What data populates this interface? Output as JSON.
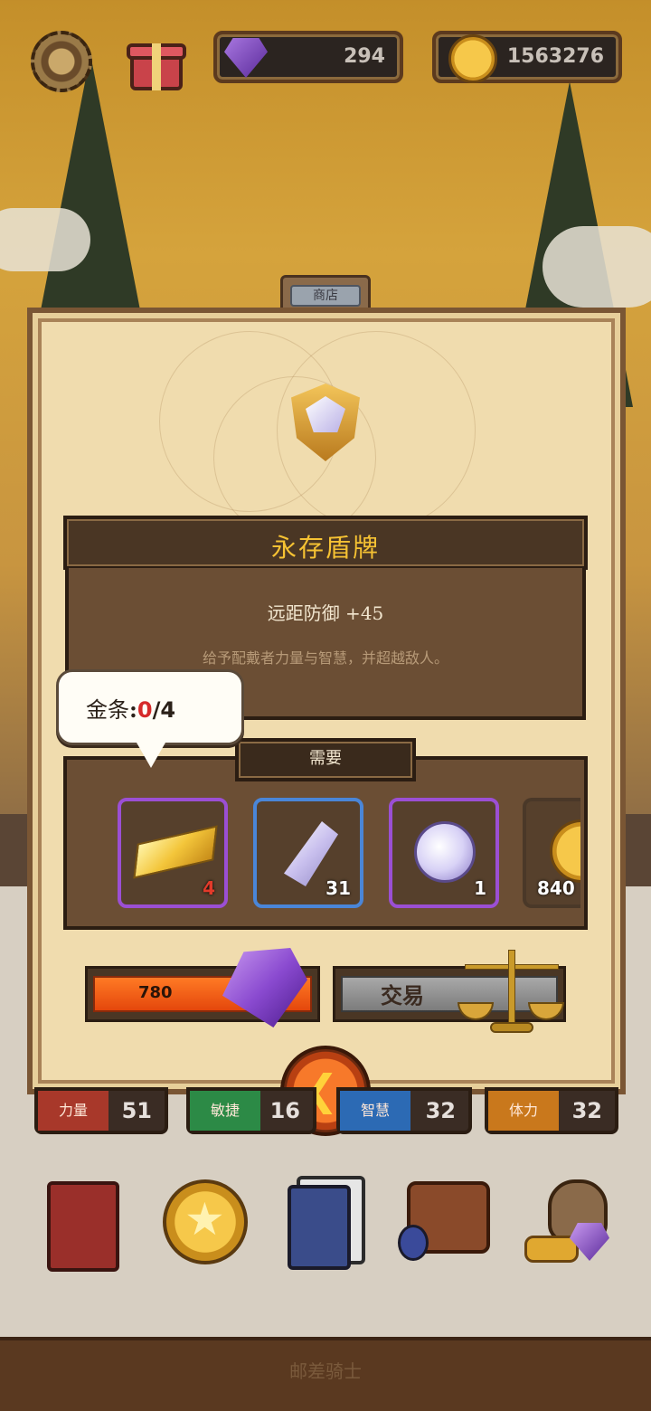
{
  "hud": {
    "gems": "294",
    "coins": "1563276",
    "icons": [
      "gear-icon",
      "gift-icon",
      "gem-icon",
      "coin-icon"
    ]
  },
  "shop": {
    "tab_label": "商店",
    "item_name": "永存盾牌",
    "stat_line": "远距防御 +45",
    "flavor": "给予配戴者力量与智慧，并超越敌人。",
    "requirements_label": "需要",
    "tooltip": {
      "label": "金条",
      "separator": ":",
      "have": "0",
      "need": "/4"
    },
    "requirements": [
      {
        "name": "gold-bar",
        "count": "4",
        "count_color": "#e23a2a",
        "rarity_color": "#9b4fd4"
      },
      {
        "name": "crystal-shard",
        "count": "31",
        "count_color": "#ffffff",
        "rarity_color": "#4a86d8"
      },
      {
        "name": "magic-orb",
        "count": "1",
        "count_color": "#ffffff",
        "rarity_color": "#9b4fd4"
      },
      {
        "name": "gold-coin",
        "count": "840",
        "count_color": "#ffffff",
        "rarity_color": "#4a3828"
      }
    ],
    "buy_price": "780",
    "trade_label": "交易",
    "back_icon": "chevron-left-icon"
  },
  "stats": [
    {
      "label": "力量",
      "value": "51",
      "color": "#a8382a"
    },
    {
      "label": "敏捷",
      "value": "16",
      "color": "#2c8a46"
    },
    {
      "label": "智慧",
      "value": "32",
      "color": "#2c6ab4"
    },
    {
      "label": "体力",
      "value": "32",
      "color": "#c9781c"
    }
  ],
  "nav": [
    "spellbook-icon",
    "coin-icon",
    "cards-icon",
    "inventory-icon",
    "loot-icon"
  ],
  "footer_title": "邮差骑士"
}
